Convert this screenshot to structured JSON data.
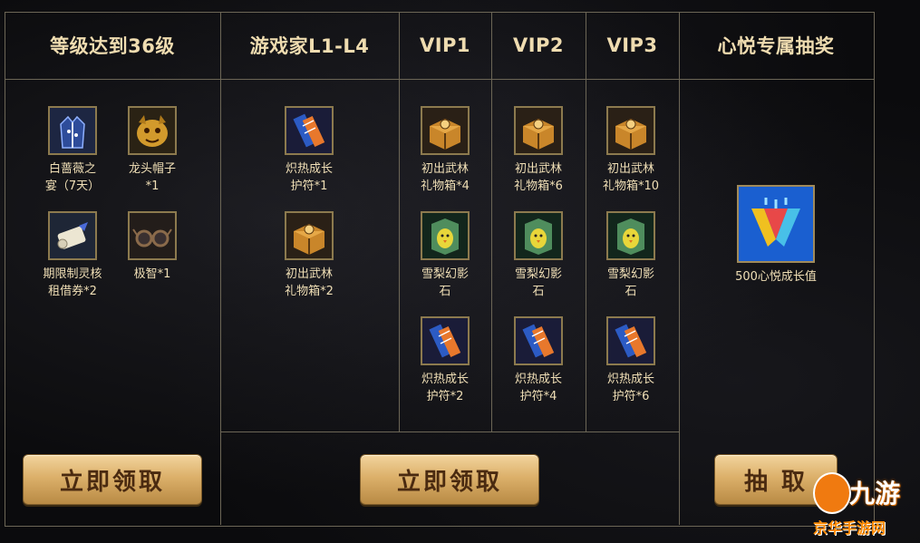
{
  "columns": {
    "level": "等级达到36级",
    "gamer": "游戏家L1-L4",
    "vip1": "VIP1",
    "vip2": "VIP2",
    "vip3": "VIP3",
    "lottery": "心悦专属抽奖"
  },
  "level_items": [
    {
      "label_1": "白蔷薇之",
      "label_2": "宴（7天）"
    },
    {
      "label_1": "龙头帽子",
      "label_2": "*1"
    },
    {
      "label_1": "期限制灵核",
      "label_2": "租借券*2"
    },
    {
      "label_1": "极智*1",
      "label_2": ""
    }
  ],
  "gamer_items": [
    {
      "label_1": "炽热成长",
      "label_2": "护符*1"
    },
    {
      "label_1": "初出武林",
      "label_2": "礼物箱*2"
    }
  ],
  "vip1_items": [
    {
      "label_1": "初出武林",
      "label_2": "礼物箱*4"
    },
    {
      "label_1": "雪梨幻影",
      "label_2": "石"
    },
    {
      "label_1": "炽热成长",
      "label_2": "护符*2"
    }
  ],
  "vip2_items": [
    {
      "label_1": "初出武林",
      "label_2": "礼物箱*6"
    },
    {
      "label_1": "雪梨幻影",
      "label_2": "石"
    },
    {
      "label_1": "炽热成长",
      "label_2": "护符*4"
    }
  ],
  "vip3_items": [
    {
      "label_1": "初出武林",
      "label_2": "礼物箱*10"
    },
    {
      "label_1": "雪梨幻影",
      "label_2": "石"
    },
    {
      "label_1": "炽热成长",
      "label_2": "护符*6"
    }
  ],
  "lottery_item": {
    "label": "500心悦成长值"
  },
  "buttons": {
    "claim_level": "立即领取",
    "claim_vip": "立即领取",
    "draw": "抽 取"
  },
  "watermark": {
    "mark": "九游",
    "site": "京华手游网"
  },
  "colors": {
    "gold_text": "#efdcb0",
    "border": "#6c6656",
    "button_gold": "#dcb06a"
  }
}
